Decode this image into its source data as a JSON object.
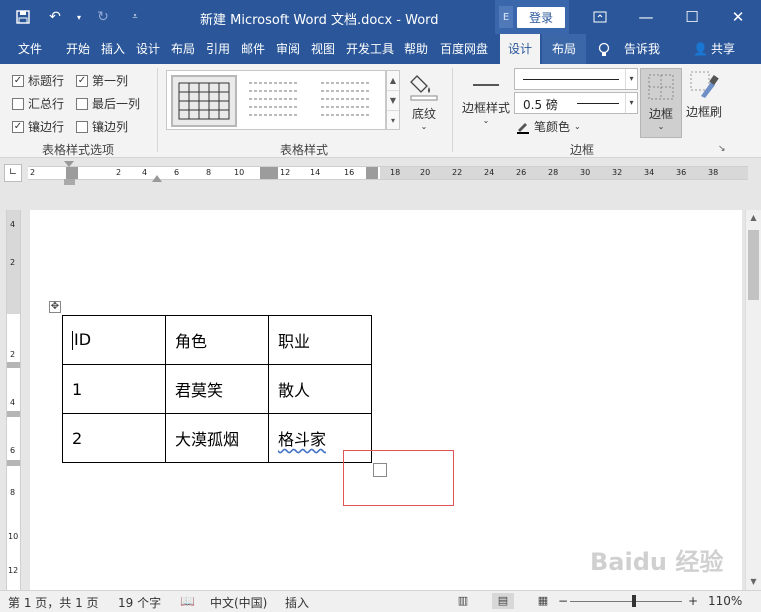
{
  "window": {
    "title": "新建 Microsoft Word 文档.docx  -  Word",
    "login_label": "登录",
    "login_mini": "E"
  },
  "tabs": [
    {
      "label": "文件"
    },
    {
      "label": "开始"
    },
    {
      "label": "插入"
    },
    {
      "label": "设计"
    },
    {
      "label": "布局"
    },
    {
      "label": "引用"
    },
    {
      "label": "邮件"
    },
    {
      "label": "审阅"
    },
    {
      "label": "视图"
    },
    {
      "label": "开发工具"
    },
    {
      "label": "帮助"
    },
    {
      "label": "百度网盘"
    },
    {
      "label": "设计"
    },
    {
      "label": "布局"
    }
  ],
  "tell_me": "告诉我",
  "share": "共享",
  "ribbon": {
    "style_options": {
      "label": "表格样式选项",
      "items": [
        {
          "label": "标题行",
          "checked": true
        },
        {
          "label": "第一列",
          "checked": true
        },
        {
          "label": "汇总行",
          "checked": false
        },
        {
          "label": "最后一列",
          "checked": false
        },
        {
          "label": "镶边行",
          "checked": true
        },
        {
          "label": "镶边列",
          "checked": false
        }
      ]
    },
    "table_styles": {
      "label": "表格样式",
      "shading": "底纹"
    },
    "borders": {
      "label": "边框",
      "border_style": "边框样式",
      "width": "0.5 磅",
      "pen_color": "笔颜色",
      "border_button": "边框",
      "border_painter": "边框刷"
    }
  },
  "ruler": {
    "h_labels": [
      "2",
      "2",
      "4",
      "6",
      "8",
      "10",
      "12",
      "14",
      "16",
      "18",
      "20",
      "22",
      "24",
      "26",
      "28",
      "30",
      "32",
      "34",
      "36",
      "38"
    ],
    "v_labels": [
      "4",
      "2",
      "2",
      "4",
      "6",
      "8",
      "10",
      "12"
    ]
  },
  "document": {
    "table": [
      [
        "ID",
        "角色",
        "职业"
      ],
      [
        "1",
        "君莫笑",
        "散人"
      ],
      [
        "2",
        "大漠孤烟",
        "格斗家"
      ]
    ]
  },
  "status": {
    "page": "第 1 页，共 1 页",
    "words": "19 个字",
    "language": "中文(中国)",
    "mode": "插入",
    "zoom": "110%",
    "zoom_value": 110
  },
  "watermark": "Baidu 经验",
  "colors": {
    "accent": "#2b579a",
    "selection": "#e05555"
  }
}
